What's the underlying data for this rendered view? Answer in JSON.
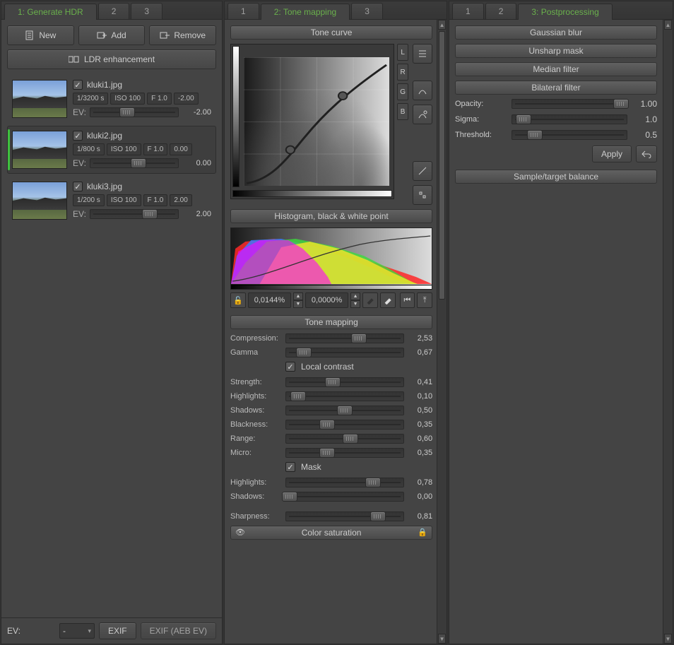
{
  "panel1": {
    "tabs": [
      "1: Generate HDR",
      "2",
      "3"
    ],
    "active": 0,
    "buttons": {
      "new": "New",
      "add": "Add",
      "remove": "Remove",
      "ldr": "LDR enhancement"
    },
    "images": [
      {
        "file": "kluki1.jpg",
        "checked": true,
        "shutter": "1/3200 s",
        "iso": "ISO 100",
        "f": "F 1.0",
        "ev_badge": "-2.00",
        "ev_label": "EV:",
        "ev_val": "-2.00",
        "knob": 42
      },
      {
        "file": "kluki2.jpg",
        "checked": true,
        "shutter": "1/800 s",
        "iso": "ISO 100",
        "f": "F 1.0",
        "ev_badge": "0.00",
        "ev_label": "EV:",
        "ev_val": "0.00",
        "knob": 55,
        "selected": true
      },
      {
        "file": "kluki3.jpg",
        "checked": true,
        "shutter": "1/200 s",
        "iso": "ISO 100",
        "f": "F 1.0",
        "ev_badge": "2.00",
        "ev_label": "EV:",
        "ev_val": "2.00",
        "knob": 68
      }
    ],
    "footer": {
      "ev": "EV:",
      "select": "-",
      "exif": "EXIF",
      "exif_aeb": "EXIF (AEB EV)"
    }
  },
  "panel2": {
    "tabs": [
      "1",
      "2: Tone mapping",
      "3"
    ],
    "active": 1,
    "sections": {
      "tone_curve": "Tone curve",
      "hist": "Histogram, black & white point",
      "tone_mapping": "Tone mapping",
      "color_sat": "Color saturation"
    },
    "channels": [
      "L",
      "R",
      "G",
      "B"
    ],
    "bp": "0,0144%",
    "wp": "0,0000%",
    "params": {
      "compression": {
        "label": "Compression:",
        "val": "2,53",
        "knob": 62
      },
      "gamma": {
        "label": "Gamma",
        "val": "0,67",
        "knob": 15
      },
      "local_contrast": "Local contrast",
      "strength": {
        "label": "Strength:",
        "val": "0,41",
        "knob": 40
      },
      "highlights": {
        "label": "Highlights:",
        "val": "0,10",
        "knob": 10
      },
      "shadows": {
        "label": "Shadows:",
        "val": "0,50",
        "knob": 50
      },
      "blackness": {
        "label": "Blackness:",
        "val": "0,35",
        "knob": 35
      },
      "range": {
        "label": "Range:",
        "val": "0,60",
        "knob": 55
      },
      "micro": {
        "label": "Micro:",
        "val": "0,35",
        "knob": 35
      },
      "mask": "Mask",
      "m_highlights": {
        "label": "Highlights:",
        "val": "0,78",
        "knob": 74
      },
      "m_shadows": {
        "label": "Shadows:",
        "val": "0,00",
        "knob": 3
      },
      "sharpness": {
        "label": "Sharpness:",
        "val": "0,81",
        "knob": 78
      }
    }
  },
  "panel3": {
    "tabs": [
      "1",
      "2",
      "3: Postprocessing"
    ],
    "active": 2,
    "filters": {
      "gauss": "Gaussian blur",
      "unsharp": "Unsharp mask",
      "median": "Median filter",
      "bilateral": "Bilateral filter"
    },
    "bilateral": {
      "opacity": {
        "label": "Opacity:",
        "val": "1.00",
        "knob": 95
      },
      "sigma": {
        "label": "Sigma:",
        "val": "1.0",
        "knob": 10
      },
      "threshold": {
        "label": "Threshold:",
        "val": "0.5",
        "knob": 20
      }
    },
    "apply": "Apply",
    "sample": "Sample/target balance"
  }
}
